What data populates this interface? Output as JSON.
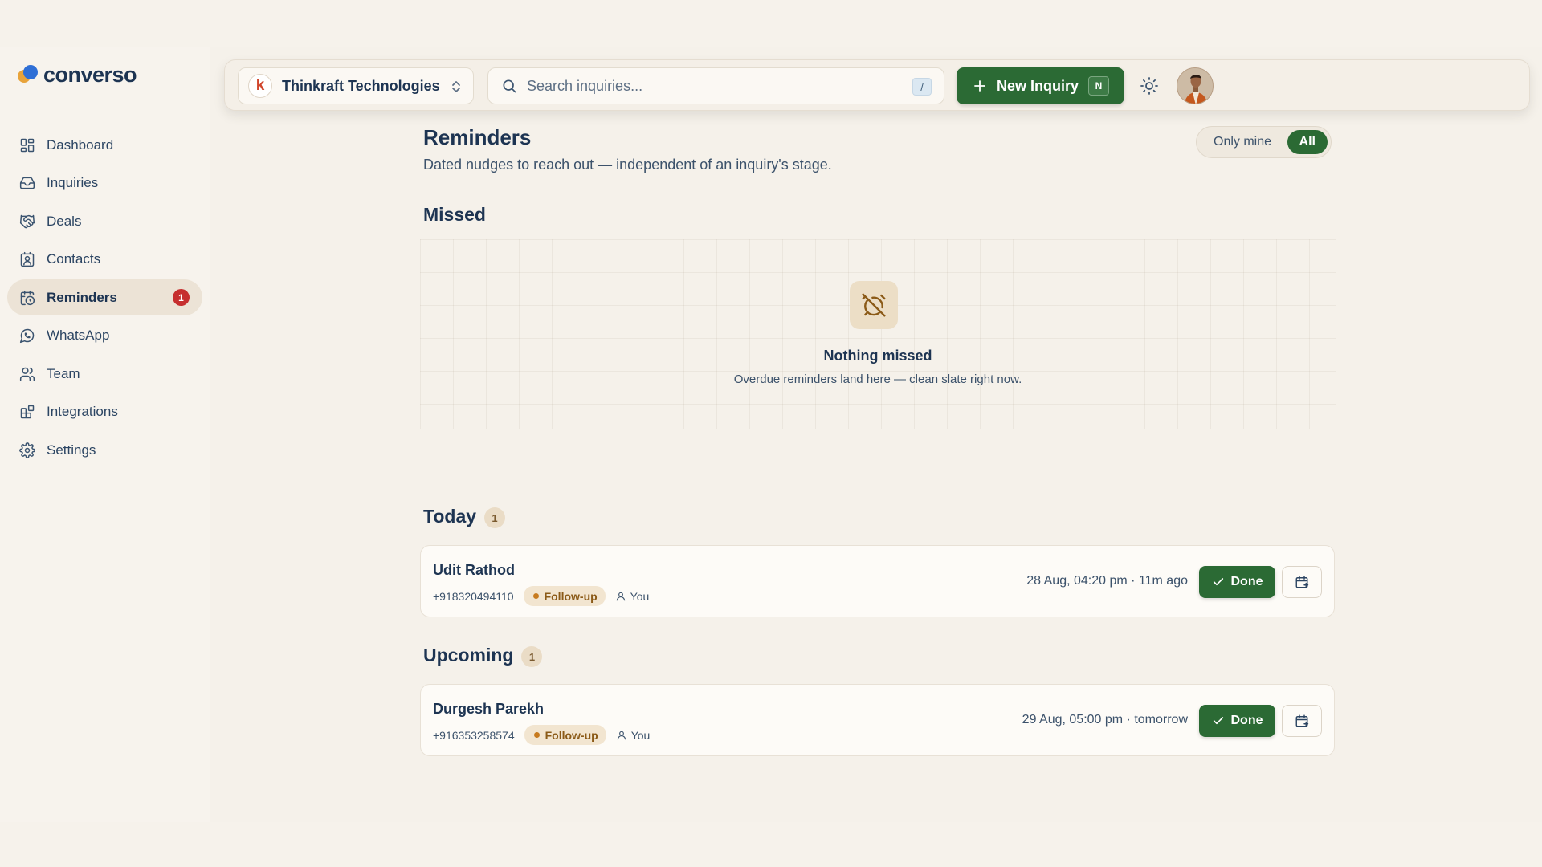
{
  "brand": {
    "name": "converso"
  },
  "sidebar": {
    "items": [
      {
        "label": "Dashboard",
        "icon": "dashboard-icon"
      },
      {
        "label": "Inquiries",
        "icon": "inbox-icon"
      },
      {
        "label": "Deals",
        "icon": "handshake-icon"
      },
      {
        "label": "Contacts",
        "icon": "contact-card-icon"
      },
      {
        "label": "Reminders",
        "icon": "calendar-clock-icon",
        "active": true,
        "badge": "1"
      },
      {
        "label": "WhatsApp",
        "icon": "whatsapp-icon"
      },
      {
        "label": "Team",
        "icon": "users-icon"
      },
      {
        "label": "Integrations",
        "icon": "blocks-icon"
      },
      {
        "label": "Settings",
        "icon": "gear-icon"
      }
    ]
  },
  "topbar": {
    "org": {
      "initial": "k",
      "name": "Thinkraft Technologies"
    },
    "search": {
      "placeholder": "Search inquiries...",
      "value": "",
      "shortcut": "/"
    },
    "new_inquiry": {
      "label": "New Inquiry",
      "shortcut": "N"
    }
  },
  "page": {
    "title": "Reminders",
    "subtitle": "Dated nudges to reach out — independent of an inquiry's stage.",
    "filter": {
      "options": [
        "Only mine",
        "All"
      ],
      "selected": "All"
    }
  },
  "sections": {
    "missed": {
      "title": "Missed",
      "empty_title": "Nothing missed",
      "empty_subtitle": "Overdue reminders land here — clean slate right now."
    },
    "today": {
      "title": "Today",
      "count": "1",
      "items": [
        {
          "name": "Udit Rathod",
          "phone": "+918320494110",
          "tag": "Follow-up",
          "owner": "You",
          "when": "28 Aug, 04:20 pm · 11m ago",
          "done_label": "Done"
        }
      ]
    },
    "upcoming": {
      "title": "Upcoming",
      "count": "1",
      "items": [
        {
          "name": "Durgesh Parekh",
          "phone": "+916353258574",
          "tag": "Follow-up",
          "owner": "You",
          "when": "29 Aug, 05:00 pm · tomorrow",
          "done_label": "Done"
        }
      ]
    }
  },
  "colors": {
    "accent": "#2b6a34",
    "badge": "#c62f2f",
    "tag_bg": "#f2e5d0",
    "tag_text": "#8b5a17"
  }
}
